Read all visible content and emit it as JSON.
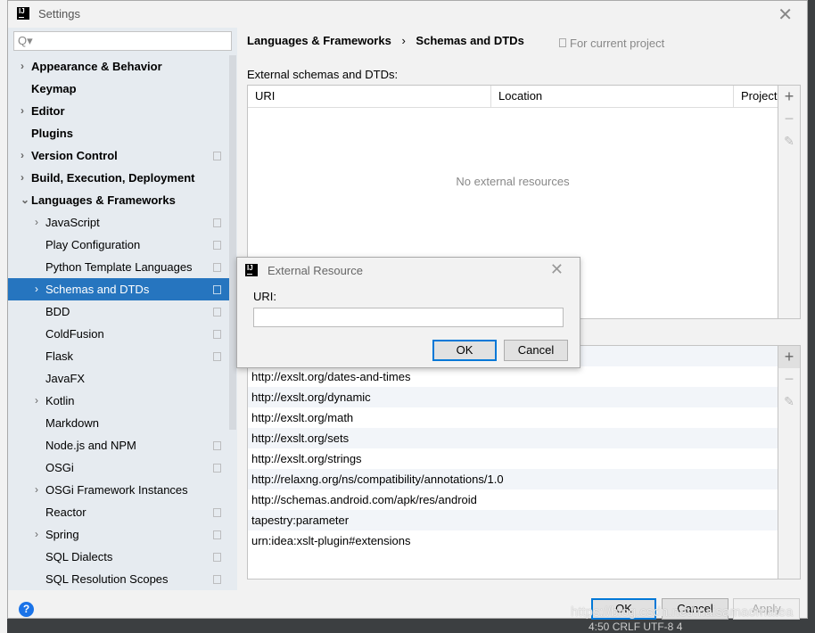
{
  "window": {
    "title": "Settings"
  },
  "search": {
    "placeholder": "Q▾"
  },
  "sidebar": {
    "items": [
      {
        "label": "Appearance & Behavior",
        "bold": true,
        "arrow": "›",
        "indent": 0,
        "project": false
      },
      {
        "label": "Keymap",
        "bold": true,
        "arrow": "",
        "indent": 0,
        "project": false
      },
      {
        "label": "Editor",
        "bold": true,
        "arrow": "›",
        "indent": 0,
        "project": false
      },
      {
        "label": "Plugins",
        "bold": true,
        "arrow": "",
        "indent": 0,
        "project": false
      },
      {
        "label": "Version Control",
        "bold": true,
        "arrow": "›",
        "indent": 0,
        "project": true
      },
      {
        "label": "Build, Execution, Deployment",
        "bold": true,
        "arrow": "›",
        "indent": 0,
        "project": false
      },
      {
        "label": "Languages & Frameworks",
        "bold": true,
        "arrow": "⌄",
        "indent": 0,
        "project": false
      },
      {
        "label": "JavaScript",
        "arrow": "›",
        "indent": 1,
        "project": true
      },
      {
        "label": "Play Configuration",
        "arrow": "",
        "indent": 1,
        "project": true
      },
      {
        "label": "Python Template Languages",
        "arrow": "",
        "indent": 1,
        "project": true
      },
      {
        "label": "Schemas and DTDs",
        "arrow": "›",
        "indent": 1,
        "project": true,
        "selected": true
      },
      {
        "label": "BDD",
        "arrow": "",
        "indent": 1,
        "project": true
      },
      {
        "label": "ColdFusion",
        "arrow": "",
        "indent": 1,
        "project": true
      },
      {
        "label": "Flask",
        "arrow": "",
        "indent": 1,
        "project": true
      },
      {
        "label": "JavaFX",
        "arrow": "",
        "indent": 1,
        "project": false
      },
      {
        "label": "Kotlin",
        "arrow": "›",
        "indent": 1,
        "project": false
      },
      {
        "label": "Markdown",
        "arrow": "",
        "indent": 1,
        "project": false
      },
      {
        "label": "Node.js and NPM",
        "arrow": "",
        "indent": 1,
        "project": true
      },
      {
        "label": "OSGi",
        "arrow": "",
        "indent": 1,
        "project": true
      },
      {
        "label": "OSGi Framework Instances",
        "arrow": "›",
        "indent": 1,
        "project": false
      },
      {
        "label": "Reactor",
        "arrow": "",
        "indent": 1,
        "project": true
      },
      {
        "label": "Spring",
        "arrow": "›",
        "indent": 1,
        "project": true
      },
      {
        "label": "SQL Dialects",
        "arrow": "",
        "indent": 1,
        "project": true
      },
      {
        "label": "SQL Resolution Scopes",
        "arrow": "",
        "indent": 1,
        "project": true
      }
    ]
  },
  "main": {
    "breadcrumb": [
      "Languages & Frameworks",
      "›",
      "Schemas and DTDs"
    ],
    "for_current_project": "For current project",
    "external_label": "External schemas and DTDs:",
    "columns": [
      "URI",
      "Location",
      "Project"
    ],
    "empty_text": "No external resources",
    "ignored_rows": [
      "",
      "http://exslt.org/dates-and-times",
      "http://exslt.org/dynamic",
      "http://exslt.org/math",
      "http://exslt.org/sets",
      "http://exslt.org/strings",
      "http://relaxng.org/ns/compatibility/annotations/1.0",
      "http://schemas.android.com/apk/res/android",
      "tapestry:parameter",
      "urn:idea:xslt-plugin#extensions"
    ]
  },
  "toolbar": {
    "add": "+",
    "remove": "−",
    "edit": "✎"
  },
  "footer": {
    "help": "?",
    "ok": "OK",
    "cancel": "Cancel",
    "apply": "Apply"
  },
  "dialog": {
    "title": "External Resource",
    "uri_label": "URI:",
    "uri_value": "",
    "ok": "OK",
    "cancel": "Cancel"
  },
  "watermark": "https://blog.csdn.net/maisamaomatea",
  "status_text": "4:50  CRLF  UTF-8  4"
}
